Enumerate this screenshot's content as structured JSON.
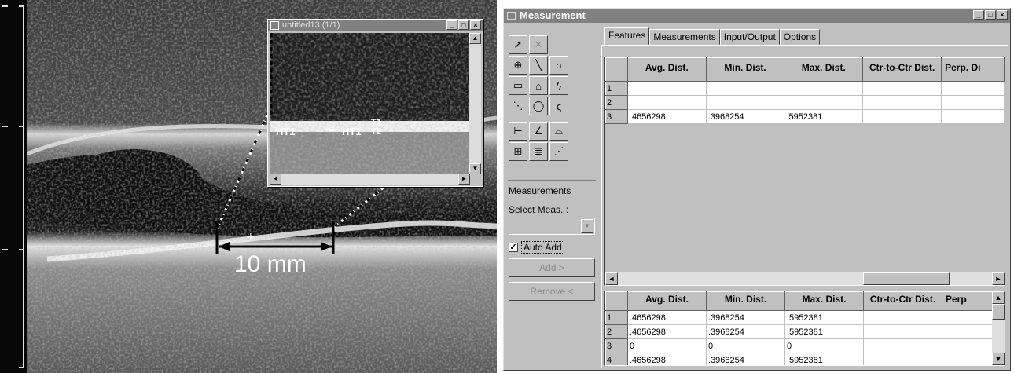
{
  "ultrasound": {
    "scale_label": "10 mm",
    "zoom_window": {
      "title": "untitled13 (1/1)",
      "labels": {
        "ht1_left": "HT1",
        "ht1_right": "HT1",
        "t1": "T1",
        "t2": "T2"
      }
    }
  },
  "measurement_window": {
    "title": "Measurement",
    "title_buttons": [
      "_",
      "□",
      "×"
    ],
    "tabs": [
      "Features",
      "Measurements",
      "Input/Output",
      "Options"
    ],
    "active_tab": "Features",
    "tools": [
      "pointer-icon",
      "delete-icon",
      "crosshair-icon",
      "line-icon",
      "circle-icon",
      "rectangle-icon",
      "polygon-icon",
      "freehand-icon",
      "multiline-icon",
      "ellipse-icon",
      "curve-icon",
      "distance-icon",
      "angle-icon",
      "calipers-icon",
      "thickness-icon",
      "parallel-icon",
      "diagonal-icon"
    ],
    "side": {
      "section_label": "Measurements",
      "select_label": "Select Meas. :",
      "select_value": "",
      "auto_add_label": "Auto Add",
      "auto_add_checked": true,
      "add_button": "Add >",
      "remove_button": "Remove <"
    },
    "top_grid": {
      "columns": [
        "Avg. Dist.",
        "Min. Dist.",
        "Max. Dist.",
        "Ctr-to-Ctr Dist.",
        "Perp. Di"
      ],
      "rows": [
        {
          "index": "1",
          "cells": [
            "",
            "",
            "",
            "",
            ""
          ]
        },
        {
          "index": "2",
          "cells": [
            "",
            "",
            "",
            "",
            ""
          ]
        },
        {
          "index": "3",
          "cells": [
            ".4656298",
            ".3968254",
            ".5952381",
            "",
            ""
          ]
        }
      ]
    },
    "bottom_grid": {
      "columns": [
        "Avg. Dist.",
        "Min. Dist.",
        "Max. Dist.",
        "Ctr-to-Ctr Dist.",
        "Perp"
      ],
      "rows": [
        {
          "index": "1",
          "cells": [
            ".4656298",
            ".3968254",
            ".5952381",
            ""
          ]
        },
        {
          "index": "2",
          "cells": [
            ".4656298",
            ".3968254",
            ".5952381",
            ""
          ]
        },
        {
          "index": "3",
          "cells": [
            "0",
            "0",
            "0",
            ""
          ]
        },
        {
          "index": "4",
          "cells": [
            ".4656298",
            ".3968254",
            ".5952381",
            ""
          ]
        }
      ]
    }
  }
}
